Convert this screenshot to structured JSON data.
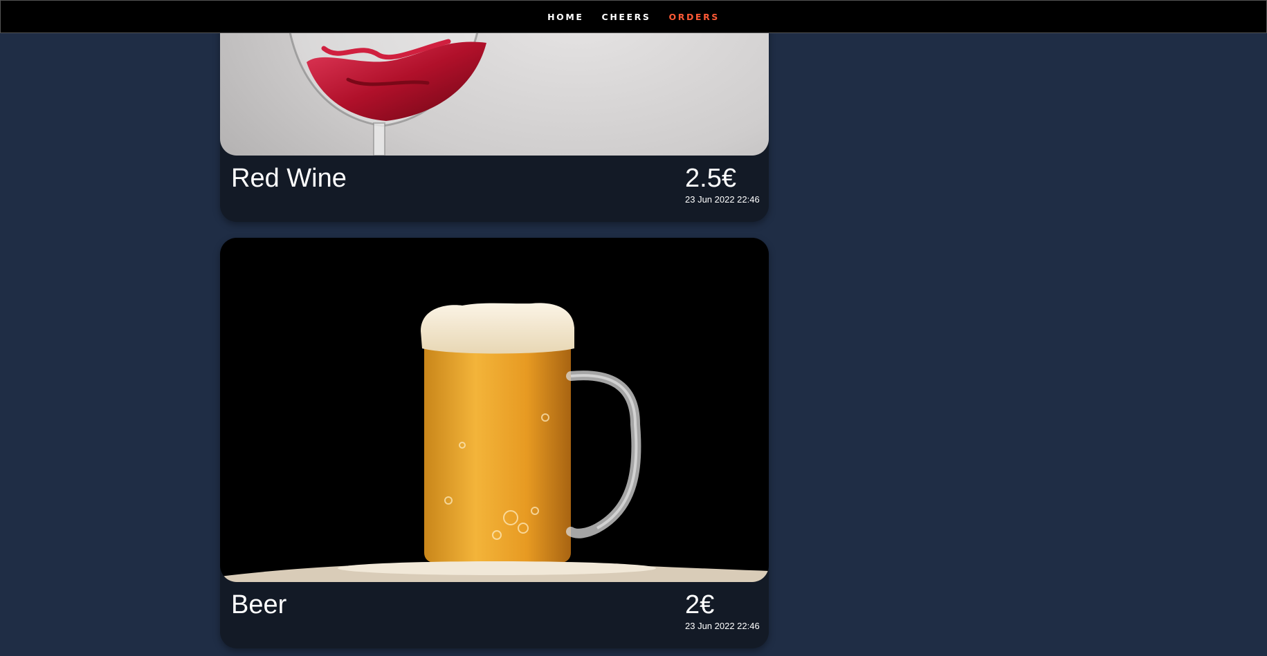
{
  "nav": {
    "items": [
      {
        "label": "HOME",
        "active": false
      },
      {
        "label": "CHEERS",
        "active": false
      },
      {
        "label": "ORDERS",
        "active": true
      }
    ],
    "active_color": "#ff5a36"
  },
  "orders": [
    {
      "name": "Red Wine",
      "price": "2.5€",
      "time": "23 Jun 2022 22:46",
      "image": "red-wine-glass"
    },
    {
      "name": "Beer",
      "price": "2€",
      "time": "23 Jun 2022 22:46",
      "image": "beer-mug"
    }
  ],
  "colors": {
    "background": "#1f2d45",
    "card": "#131a26",
    "navbar": "#000000"
  }
}
